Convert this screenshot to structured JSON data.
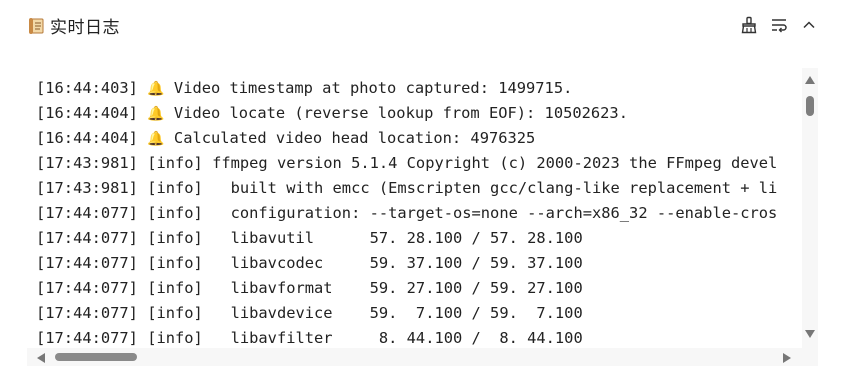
{
  "header": {
    "title": "实时日志",
    "title_icon": "scroll-icon",
    "actions": [
      {
        "name": "clear-logs-button",
        "icon": "broom-icon"
      },
      {
        "name": "wrap-lines-button",
        "icon": "wrap-text-icon"
      },
      {
        "name": "collapse-button",
        "icon": "chevron-up-icon"
      }
    ]
  },
  "log": {
    "lines": [
      {
        "ts": "[16:44:403]",
        "icon": "🔔",
        "msg": " Video timestamp at photo captured: 1499715."
      },
      {
        "ts": "[16:44:404]",
        "icon": "🔔",
        "msg": " Video locate (reverse lookup from EOF): 10502623."
      },
      {
        "ts": "[16:44:404]",
        "icon": "🔔",
        "msg": " Calculated video head location: 4976325"
      },
      {
        "ts": "[17:43:981]",
        "icon": "",
        "msg": "[info] ffmpeg version 5.1.4 Copyright (c) 2000-2023 the FFmpeg devel"
      },
      {
        "ts": "[17:43:981]",
        "icon": "",
        "msg": "[info]   built with emcc (Emscripten gcc/clang-like replacement + li"
      },
      {
        "ts": "[17:44:077]",
        "icon": "",
        "msg": "[info]   configuration: --target-os=none --arch=x86_32 --enable-cros"
      },
      {
        "ts": "[17:44:077]",
        "icon": "",
        "msg": "[info]   libavutil      57. 28.100 / 57. 28.100"
      },
      {
        "ts": "[17:44:077]",
        "icon": "",
        "msg": "[info]   libavcodec     59. 37.100 / 59. 37.100"
      },
      {
        "ts": "[17:44:077]",
        "icon": "",
        "msg": "[info]   libavformat    59. 27.100 / 59. 27.100"
      },
      {
        "ts": "[17:44:077]",
        "icon": "",
        "msg": "[info]   libavdevice    59.  7.100 / 59.  7.100"
      },
      {
        "ts": "[17:44:077]",
        "icon": "",
        "msg": "[info]   libavfilter     8. 44.100 /  8. 44.100"
      }
    ]
  },
  "colors": {
    "icon": "#333333",
    "bell": "#e8893a",
    "scrollbar_thumb": "#7e7e7e",
    "scrollbar_track": "#f7f7f7"
  }
}
